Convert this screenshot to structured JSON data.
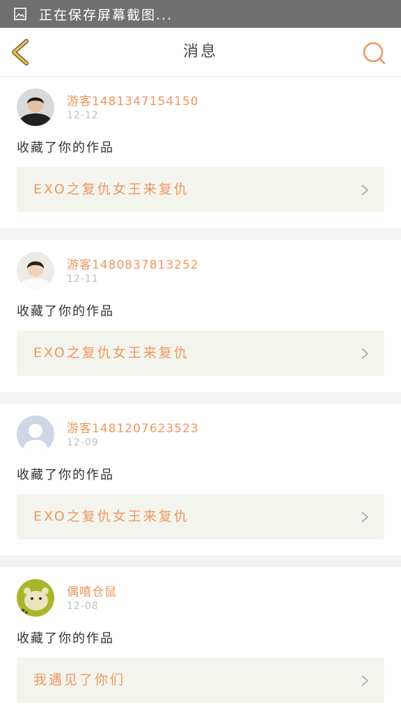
{
  "status_bar": {
    "text": "正在保存屏幕截图..."
  },
  "header": {
    "title": "消息"
  },
  "messages": [
    {
      "username": "游客1481347154150",
      "date": "12-12",
      "action": "收藏了你的作品",
      "work_title": "EXO之复仇女王来复仇"
    },
    {
      "username": "游客1480837813252",
      "date": "12-11",
      "action": "收藏了你的作品",
      "work_title": "EXO之复仇女王来复仇"
    },
    {
      "username": "游客1481207623523",
      "date": "12-09",
      "action": "收藏了你的作品",
      "work_title": "EXO之复仇女王来复仇"
    },
    {
      "username": "偶嘻仓鼠",
      "date": "12-08",
      "action": "收藏了你的作品",
      "work_title": "我遇见了你们"
    }
  ],
  "colors": {
    "accent": "#f0965d",
    "back_arrow": "#e8c23a",
    "work_bg": "#f4f4ee"
  }
}
